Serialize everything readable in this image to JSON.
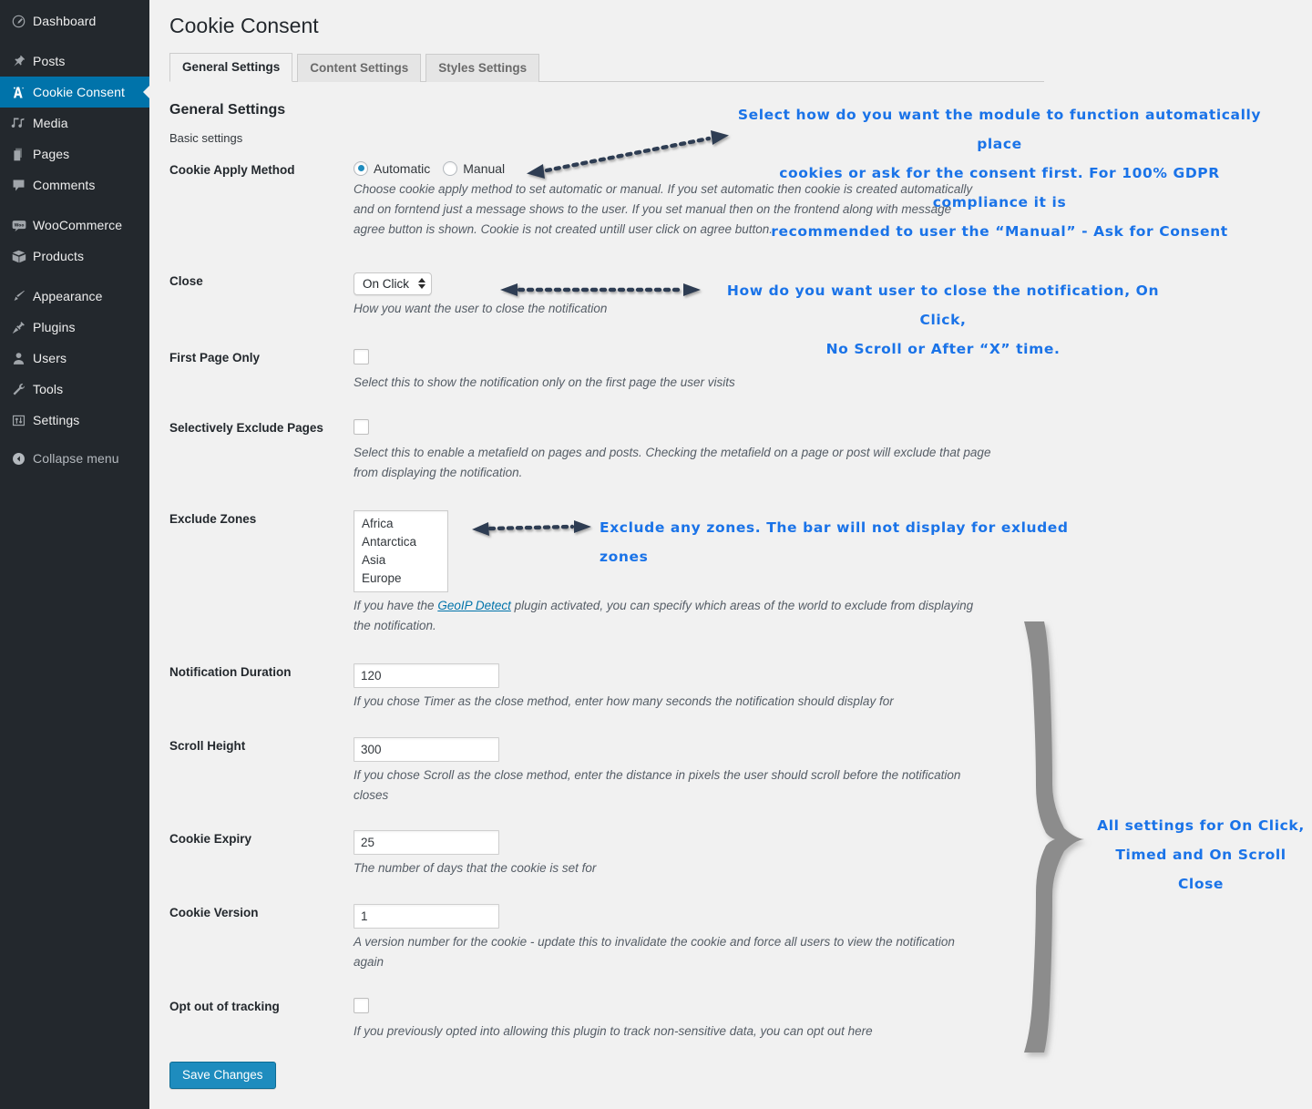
{
  "sidebar": {
    "items": [
      {
        "label": "Dashboard",
        "icon": "dashboard-icon",
        "active": false,
        "gap": false
      },
      {
        "label": "Posts",
        "icon": "pin-icon",
        "active": false,
        "gap": true
      },
      {
        "label": "Cookie Consent",
        "icon": "cookie-consent-icon",
        "active": true,
        "gap": false
      },
      {
        "label": "Media",
        "icon": "media-icon",
        "active": false,
        "gap": false
      },
      {
        "label": "Pages",
        "icon": "pages-icon",
        "active": false,
        "gap": false
      },
      {
        "label": "Comments",
        "icon": "comments-icon",
        "active": false,
        "gap": false
      },
      {
        "label": "WooCommerce",
        "icon": "woocommerce-icon",
        "active": false,
        "gap": true
      },
      {
        "label": "Products",
        "icon": "products-box-icon",
        "active": false,
        "gap": false
      },
      {
        "label": "Appearance",
        "icon": "brush-icon",
        "active": false,
        "gap": true
      },
      {
        "label": "Plugins",
        "icon": "plug-icon",
        "active": false,
        "gap": false
      },
      {
        "label": "Users",
        "icon": "user-icon",
        "active": false,
        "gap": false
      },
      {
        "label": "Tools",
        "icon": "wrench-icon",
        "active": false,
        "gap": false
      },
      {
        "label": "Settings",
        "icon": "sliders-icon",
        "active": false,
        "gap": false
      }
    ],
    "collapse_label": "Collapse menu",
    "collapse_icon": "collapse-arrow-icon",
    "bg_color": "#23282d",
    "active_color": "#0073aa"
  },
  "header": {
    "title": "Cookie Consent"
  },
  "tabs": [
    {
      "label": "General Settings",
      "active": true
    },
    {
      "label": "Content Settings",
      "active": false
    },
    {
      "label": "Styles Settings",
      "active": false
    }
  ],
  "section": {
    "heading": "General Settings",
    "subheading": "Basic settings"
  },
  "fields": {
    "cookie_apply_method": {
      "label": "Cookie Apply Method",
      "options": [
        {
          "label": "Automatic",
          "selected": true
        },
        {
          "label": "Manual",
          "selected": false
        }
      ],
      "description": "Choose cookie apply method to set automatic or manual. If you set automatic then cookie is created automatically and on forntend just a message shows to the user. If you set manual then on the frontend along with message agree button is shown. Cookie is not created untill user click on agree button."
    },
    "close": {
      "label": "Close",
      "value": "On Click",
      "description": "How you want the user to close the notification"
    },
    "first_page_only": {
      "label": "First Page Only",
      "checked": false,
      "description": "Select this to show the notification only on the first page the user visits"
    },
    "selectively_exclude_pages": {
      "label": "Selectively Exclude Pages",
      "checked": false,
      "description": "Select this to enable a metafield on pages and posts. Checking the metafield on a page or post will exclude that page from displaying the notification."
    },
    "exclude_zones": {
      "label": "Exclude Zones",
      "options": [
        "Africa",
        "Antarctica",
        "Asia",
        "Europe"
      ],
      "description_before": "If you have the ",
      "description_link": "GeoIP Detect",
      "description_after": " plugin activated, you can specify which areas of the world to exclude from displaying the notification."
    },
    "notification_duration": {
      "label": "Notification Duration",
      "value": "120",
      "description": "If you chose Timer as the close method, enter how many seconds the notification should display for"
    },
    "scroll_height": {
      "label": "Scroll Height",
      "value": "300",
      "description": "If you chose Scroll as the close method, enter the distance in pixels the user should scroll before the notification closes"
    },
    "cookie_expiry": {
      "label": "Cookie Expiry",
      "value": "25",
      "description": "The number of days that the cookie is set for"
    },
    "cookie_version": {
      "label": "Cookie Version",
      "value": "1",
      "description": "A version number for the cookie - update this to invalidate the cookie and force all users to view the notification again"
    },
    "opt_out_of_tracking": {
      "label": "Opt out of tracking",
      "checked": false,
      "description": "If you previously opted into allowing this plugin to track non-sensitive data, you can opt out here"
    }
  },
  "save_button": {
    "label": "Save Changes"
  },
  "annotations": {
    "color": "#1a73e8",
    "arrow_color": "#2e3d52",
    "brace_color": "#8c8c8c",
    "items": [
      {
        "name": "annotation-cookie-apply-method",
        "text": "Select how do you want the module to function automatically place\ncookies or ask for the consent first. For 100% GDPR compliance it is\nrecommended to user the “Manual” - Ask for Consent"
      },
      {
        "name": "annotation-close",
        "text": "How do you want user to close the notification, On Click,\nNo Scroll or After “X” time."
      },
      {
        "name": "annotation-exclude-zones",
        "text": "Exclude any zones. The bar will not display for exluded zones"
      },
      {
        "name": "annotation-close-settings-group",
        "text": "All settings for On Click,\nTimed and On Scroll Close"
      }
    ]
  }
}
